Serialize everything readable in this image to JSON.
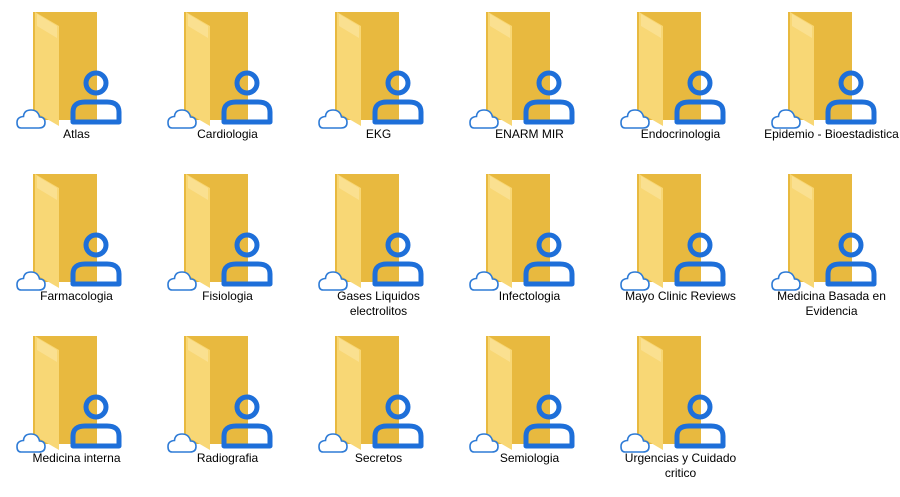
{
  "colors": {
    "folder_back": "#E8B93F",
    "folder_front": "#F8D775",
    "folder_light": "#FCE7A6",
    "person_blue": "#1E6FD9",
    "cloud_blue": "#2E7BD6"
  },
  "icons": {
    "folder": "folder-icon",
    "shared": "person-shared-icon",
    "cloud": "cloud-status-icon"
  },
  "folders": [
    {
      "label": "Atlas"
    },
    {
      "label": "Cardiologia"
    },
    {
      "label": "EKG"
    },
    {
      "label": "ENARM MIR"
    },
    {
      "label": "Endocrinologia"
    },
    {
      "label": "Epidemio - Bioestadistica"
    },
    {
      "label": "Farmacologia"
    },
    {
      "label": "Fisiologia"
    },
    {
      "label": "Gases Liquidos electrolitos"
    },
    {
      "label": "Infectologia"
    },
    {
      "label": "Mayo Clinic Reviews"
    },
    {
      "label": "Medicina Basada en Evidencia"
    },
    {
      "label": "Medicina interna"
    },
    {
      "label": "Radiografia"
    },
    {
      "label": "Secretos"
    },
    {
      "label": "Semiologia"
    },
    {
      "label": "Urgencias y Cuidado critico"
    }
  ]
}
